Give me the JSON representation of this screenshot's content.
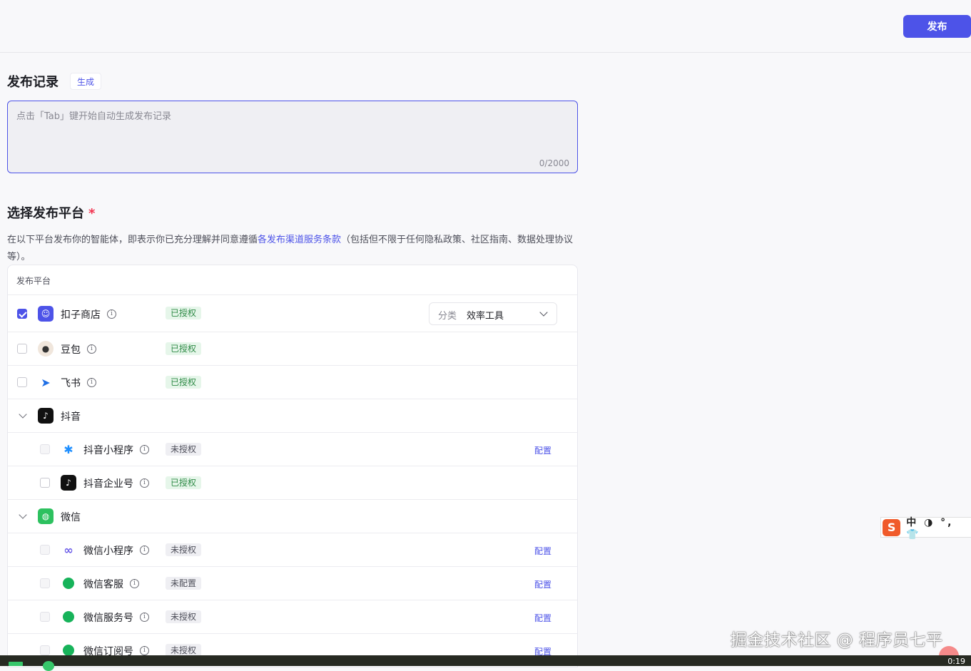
{
  "header": {
    "publish_label": "发布"
  },
  "record": {
    "title": "发布记录",
    "generate_label": "生成",
    "placeholder": "点击「Tab」键开始自动生成发布记录",
    "counter": "0/2000"
  },
  "platform": {
    "title": "选择发布平台",
    "required_mark": "*",
    "desc_prefix": "在以下平台发布你的智能体，即表示你已充分理解并同意遵循",
    "desc_link": "各发布渠道服务条款",
    "desc_suffix": "（包括但不限于任何隐私政策、社区指南、数据处理协议等）。",
    "table_header": "发布平台",
    "select": {
      "label": "分类",
      "value": "效率工具"
    },
    "rows": [
      {
        "name": "扣子商店",
        "status": "已授权",
        "checked": true
      },
      {
        "name": "豆包",
        "status": "已授权",
        "checked": false
      },
      {
        "name": "飞书",
        "status": "已授权",
        "checked": false
      },
      {
        "name": "抖音",
        "group": true
      },
      {
        "name": "抖音小程序",
        "status": "未授权",
        "config": "配置"
      },
      {
        "name": "抖音企业号",
        "status": "已授权"
      },
      {
        "name": "微信",
        "group": true
      },
      {
        "name": "微信小程序",
        "status": "未授权",
        "config": "配置"
      },
      {
        "name": "微信客服",
        "status": "未配置",
        "config": "配置"
      },
      {
        "name": "微信服务号",
        "status": "未授权",
        "config": "配置"
      },
      {
        "name": "微信订阅号",
        "status": "未授权",
        "config": "配置"
      }
    ]
  },
  "ime": {
    "logo": "S",
    "text": "中 ◑ °, 👕"
  },
  "watermark": "掘金技术社区 @ 程序员七平",
  "taskbar": {
    "clock": "0:19"
  },
  "colors": {
    "accent": "#4d53e8",
    "authorized": "#2e8a46",
    "required": "#f2334f"
  }
}
